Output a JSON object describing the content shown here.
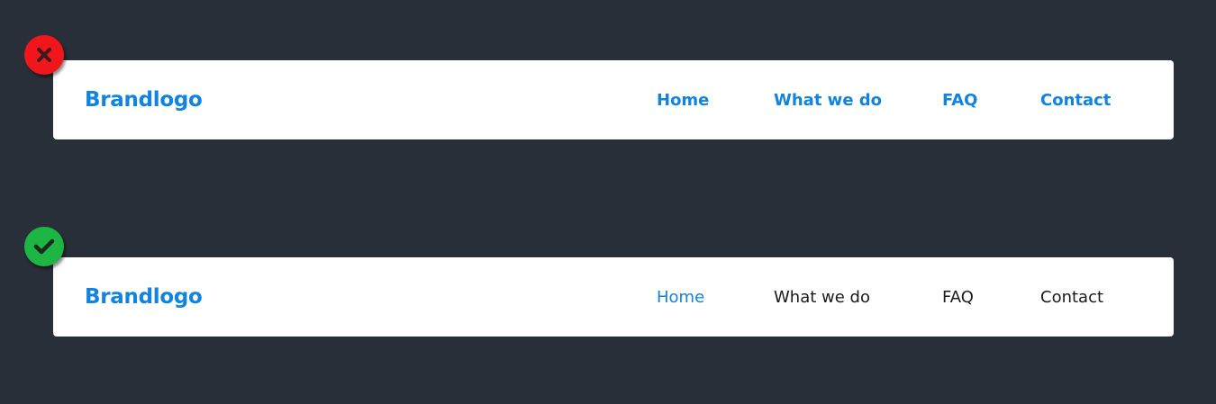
{
  "bad_example": {
    "brand": "Brandlogo",
    "links": [
      "Home",
      "What we do",
      "FAQ",
      "Contact"
    ]
  },
  "good_example": {
    "brand": "Brandlogo",
    "links": [
      "Home",
      "What we do",
      "FAQ",
      "Contact"
    ],
    "active_link": "Home"
  },
  "icons": {
    "bad_badge": "close-icon",
    "good_badge": "checkmark-icon"
  },
  "colors": {
    "background": "#282f38",
    "accent": "#1183e0",
    "bad": "#f0161c",
    "good": "#1db543",
    "text": "#1a1a1a"
  }
}
